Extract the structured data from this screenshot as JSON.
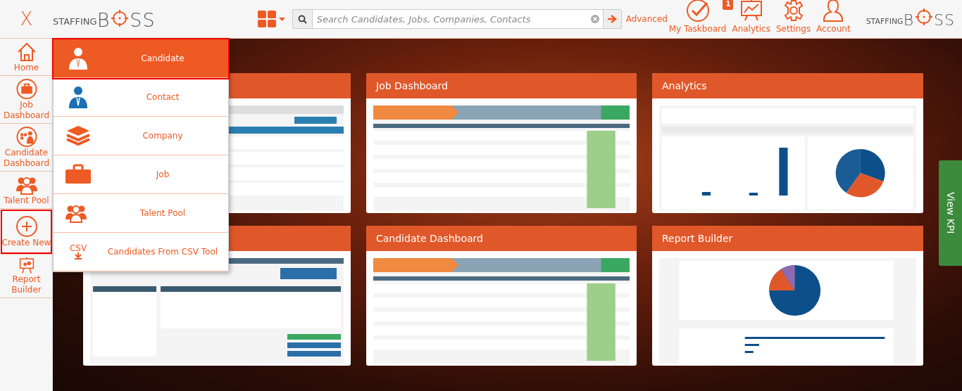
{
  "topbar": {
    "close": "X",
    "logo": {
      "small": "STAFFING",
      "big_start": "B",
      "big_end": "SS"
    },
    "search": {
      "placeholder": "Search Candidates, Jobs, Companies, Contacts"
    },
    "advanced": "Advanced",
    "tools": [
      {
        "label": "My Taskboard",
        "kind": "check",
        "badge": "1"
      },
      {
        "label": "Analytics",
        "kind": "chart"
      },
      {
        "label": "Settings",
        "kind": "gear"
      },
      {
        "label": "Account",
        "kind": "person"
      }
    ],
    "logo_right": {
      "small": "STAFFING",
      "big_start": "B",
      "big_end": "SS"
    }
  },
  "sidebar": {
    "items": [
      {
        "label": "Home",
        "kind": "home",
        "highlighted": false
      },
      {
        "label": "Job Dashboard",
        "kind": "briefcase",
        "highlighted": false
      },
      {
        "label": "Candidate Dashboard",
        "kind": "dashboard",
        "highlighted": false
      },
      {
        "label": "Talent Pool",
        "kind": "group",
        "highlighted": false
      },
      {
        "label": "Create New",
        "kind": "plus",
        "highlighted": true
      },
      {
        "label": "Report Builder",
        "kind": "easel",
        "highlighted": false
      }
    ]
  },
  "create_menu": {
    "items": [
      {
        "label": "Candidate",
        "kind": "person",
        "selected": true,
        "highlighted": true
      },
      {
        "label": "Contact",
        "kind": "contact",
        "selected": false,
        "highlighted": false
      },
      {
        "label": "Company",
        "kind": "layers",
        "selected": false,
        "highlighted": false
      },
      {
        "label": "Job",
        "kind": "briefcase",
        "selected": false,
        "highlighted": false
      },
      {
        "label": "Talent Pool",
        "kind": "group",
        "selected": false,
        "highlighted": false
      },
      {
        "label": "Candidates From CSV Tool",
        "kind": "csv",
        "icon_text": "CSV",
        "selected": false,
        "highlighted": false
      }
    ]
  },
  "cards": [
    {
      "kind": "table"
    },
    {
      "title": "Job Dashboard",
      "kind": "pipeline"
    },
    {
      "title": "Analytics",
      "kind": "report"
    },
    {
      "kind": "search"
    },
    {
      "title": "Candidate Dashboard",
      "kind": "pipeline"
    },
    {
      "title": "Report Builder",
      "kind": "builder"
    }
  ],
  "kpi_tab": "View KPI"
}
